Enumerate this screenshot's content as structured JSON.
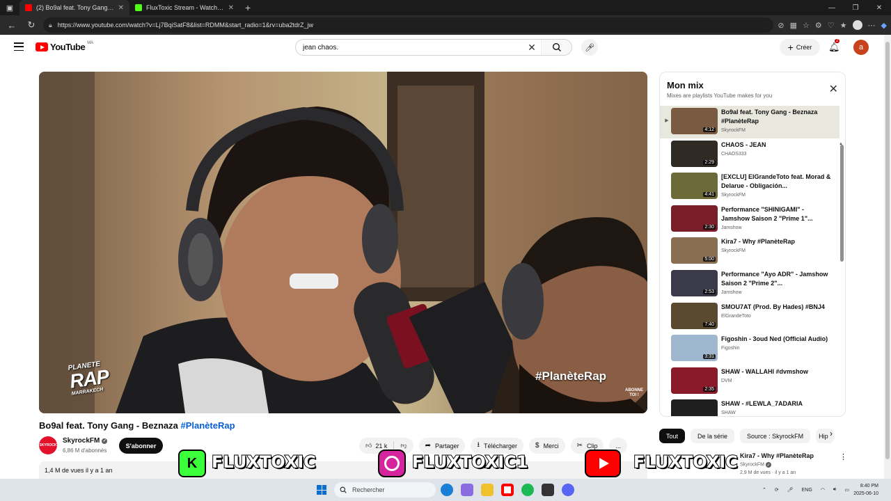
{
  "browser": {
    "tabs": [
      {
        "title": "(2) Bo9al feat. Tony Gang - B",
        "favicon_color": "#ff0000",
        "active": true
      },
      {
        "title": "FluxToxic Stream - Watch Live on",
        "favicon_color": "#53fc18",
        "active": false
      }
    ],
    "url": "https://www.youtube.com/watch?v=Lj7BqiSatF8&list=RDMM&start_radio=1&rv=uba2tdrZ_jw"
  },
  "youtube": {
    "logo": "YouTube",
    "country": "MA",
    "search_value": "jean chaos.",
    "create_label": "Créer",
    "notif_count": "2",
    "avatar_letter": "a"
  },
  "video": {
    "title": "Bo9al feat. Tony Gang - Beznaza",
    "hashtag": "#PlanèteRap",
    "overlay_hashtag": "#PlanèteRap",
    "overlay_logo": {
      "l1": "PLANETE",
      "l2": "RAP",
      "l3": "MARRAKECH"
    },
    "overlay_abonne": {
      "l1": "ABONNE",
      "l2": "TOI !"
    },
    "channel": "SkyrockFM",
    "channel_avatar": "SKYROCK",
    "subscribers": "6,86 M d'abonnés",
    "subscribe_label": "S'abonner",
    "likes": "21 k",
    "share_label": "Partager",
    "download_label": "Télécharger",
    "thanks_label": "Merci",
    "clip_label": "Clip",
    "more_label": "...",
    "views": "1,4 M de vues  il y a 1 an"
  },
  "mix": {
    "title": "Mon mix",
    "subtitle": "Mixes are playlists YouTube makes for you",
    "items": [
      {
        "title": "Bo9al feat. Tony Gang - Beznaza #PlanèteRap",
        "channel": "SkyrockFM",
        "duration": "4:12",
        "color": "#7a5a40",
        "current": true
      },
      {
        "title": "CHAOS - JEAN",
        "channel": "CHAOS333",
        "duration": "2:29",
        "color": "#2f2a24",
        "current": false
      },
      {
        "title": "[EXCLU] ElGrandeToto feat. Morad & Delarue - Obligación...",
        "channel": "SkyrockFM",
        "duration": "4:41",
        "color": "#6d6a3a",
        "current": false
      },
      {
        "title": "Performance \"SHINIGAMI\" - Jamshow Saison 2 \"Prime 1\"...",
        "channel": "Jamshow",
        "duration": "2:30",
        "color": "#7a1f2a",
        "current": false
      },
      {
        "title": "Kira7 - Why #PlanèteRap",
        "channel": "SkyrockFM",
        "duration": "5:00",
        "color": "#8a6e52",
        "current": false
      },
      {
        "title": "Performance \"Ayo ADR\" - Jamshow Saison 2 \"Prime 2\"...",
        "channel": "Jamshow",
        "duration": "2:53",
        "color": "#3a3a4a",
        "current": false
      },
      {
        "title": "SMOU7AT (Prod. By Hades) #BNJ4",
        "channel": "ElGrandeToto",
        "duration": "7:40",
        "color": "#5a4a30",
        "current": false
      },
      {
        "title": "Figoshin - 3oud Ned (Official Audio)",
        "channel": "Figoshin",
        "duration": "3:31",
        "color": "#9fb8cf",
        "current": false
      },
      {
        "title": "SHAW - WALLAHI #dvmshow",
        "channel": "DVM",
        "duration": "2:35",
        "color": "#8a1a2a",
        "current": false
      },
      {
        "title": "SHAW - #LEWLA_7ADARIA",
        "channel": "SHAW",
        "duration": "2:46",
        "color": "#1f1f1f",
        "current": false
      }
    ]
  },
  "chips": [
    "Tout",
    "De la série",
    "Source : SkyrockFM",
    "Hip"
  ],
  "recommendation": {
    "title": "Kira7 - Why #PlanèteRap",
    "channel": "SkyrockFM",
    "meta": "2,9 M de vues · il y a 1 an"
  },
  "banner": [
    {
      "icon": "K",
      "text": "FLUXTOXIC"
    },
    {
      "icon": "",
      "text": "FLUXTOXIC1"
    },
    {
      "icon": "",
      "text": "FLUXTOXIC"
    }
  ],
  "taskbar": {
    "search_placeholder": "Rechercher",
    "lang": "ENG",
    "time": "8:40 PM",
    "date": "2025-06-10"
  }
}
